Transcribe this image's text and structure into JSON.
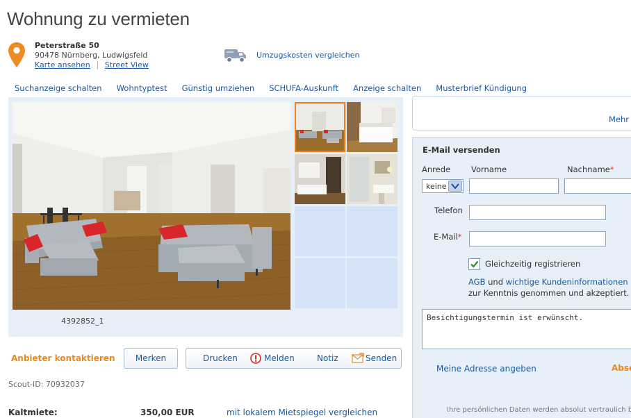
{
  "page": {
    "title": "Wohnung zu vermieten"
  },
  "address": {
    "street": "Peterstraße 50",
    "city": "90478 Nürnberg, Ludwigsfeld",
    "map_link": "Karte ansehen",
    "street_view_link": "Street View"
  },
  "moving": {
    "label": "Umzugskosten vergleichen",
    "icon": "truck-icon"
  },
  "nav": {
    "items": [
      "Suchanzeige schalten",
      "Wohntyptest",
      "Günstig umziehen",
      "SCHUFA-Auskunft",
      "Anzeige schalten",
      "Musterbrief Kündigung"
    ]
  },
  "gallery": {
    "photo_id": "4392852_1"
  },
  "actions": {
    "contact": "Anbieter kontaktieren",
    "merken": "Merken",
    "drucken": "Drucken",
    "melden": "Melden",
    "notiz": "Notiz",
    "senden": "Senden"
  },
  "listing": {
    "scout_id": "Scout-ID: 70932037",
    "kaltmiete_label": "Kaltmiete:",
    "kaltmiete_value": "350,00 EUR",
    "mietspiegel_link": "mit lokalem Mietspiegel vergleichen"
  },
  "sidebar": {
    "mehr": "Mehr"
  },
  "email_form": {
    "title": "E-Mail versenden",
    "anrede_label": "Anrede",
    "anrede_value": "keine",
    "vorname_label": "Vorname",
    "nachname_label": "Nachname",
    "telefon_label": "Telefon",
    "email_label": "E-Mail",
    "required_mark": "*",
    "register_label": "Gleichzeitig registrieren",
    "register_checked": true,
    "agb_link": "AGB",
    "and_text": "und",
    "kundeninfo_link": "wichtige Kundeninformationen",
    "accepted_text": "zur Kenntnis genommen und akzeptiert.",
    "message": "Besichtigungstermin ist erwünscht.",
    "address_link": "Meine Adresse angeben",
    "submit": "Absenden",
    "privacy": "Ihre persönlichen Daten werden absolut vertraulich be"
  },
  "colors": {
    "accent_orange": "#f0871d",
    "link_blue": "#1a5aa0",
    "panel_blue": "#e7eff9",
    "thumb_blue": "#d4e3f7"
  }
}
